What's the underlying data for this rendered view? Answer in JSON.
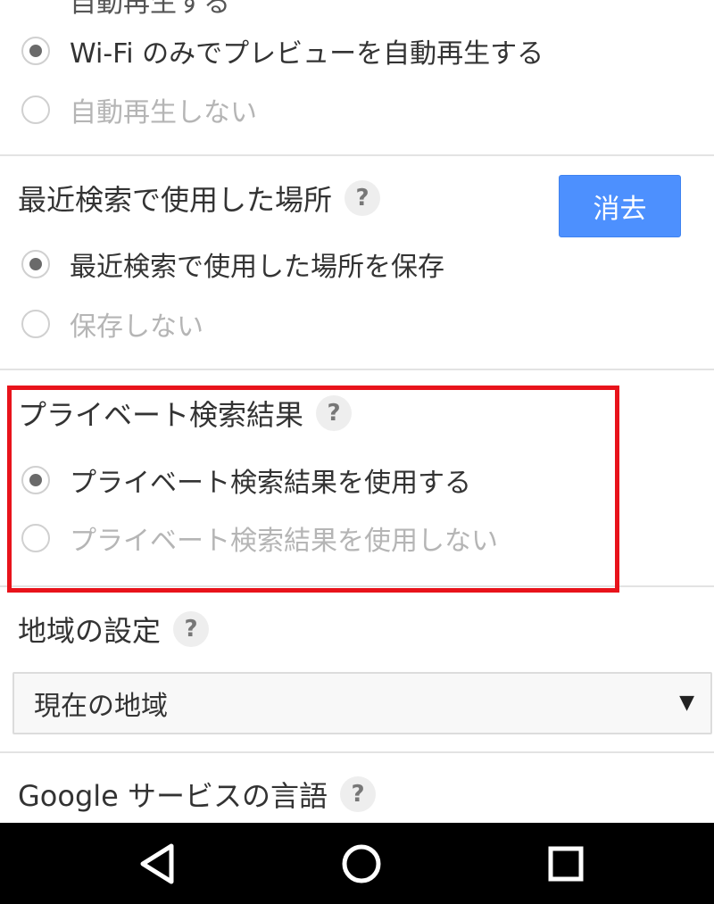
{
  "autoplay": {
    "clipped_label": "自動再生する",
    "options": [
      {
        "label": "Wi-Fi のみでプレビューを自動再生する",
        "checked": true
      },
      {
        "label": "自動再生しない",
        "checked": false
      }
    ]
  },
  "recent_places": {
    "title": "最近検索で使用した場所",
    "help": "?",
    "clear_label": "消去",
    "options": [
      {
        "label": "最近検索で使用した場所を保存",
        "checked": true
      },
      {
        "label": "保存しない",
        "checked": false
      }
    ]
  },
  "private_results": {
    "title": "プライベート検索結果",
    "help": "?",
    "options": [
      {
        "label": "プライベート検索結果を使用する",
        "checked": true
      },
      {
        "label": "プライベート検索結果を使用しない",
        "checked": false
      }
    ],
    "highlight_color": "#e8131b"
  },
  "region": {
    "title": "地域の設定",
    "help": "?",
    "selected": "現在の地域",
    "arrow": "▼"
  },
  "language": {
    "title": "Google サービスの言語",
    "help": "?"
  },
  "navbar": {
    "buttons": [
      "back-icon",
      "home-icon",
      "recents-icon"
    ]
  },
  "colors": {
    "accent": "#4d90fe",
    "highlight": "#e8131b",
    "navbar": "#000000"
  }
}
